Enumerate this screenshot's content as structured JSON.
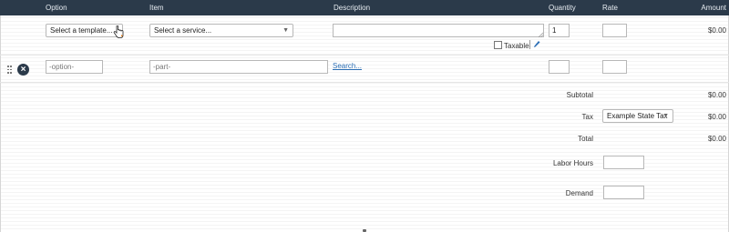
{
  "header": {
    "option": "Option",
    "item": "Item",
    "description": "Description",
    "quantity": "Quantity",
    "rate": "Rate",
    "amount": "Amount"
  },
  "row1": {
    "template_select": "Select a template...",
    "service_select": "Select a service...",
    "description_value": "",
    "quantity_value": "1",
    "rate_value": "",
    "amount": "$0.00",
    "taxable_label": "Taxable"
  },
  "row2": {
    "option_placeholder": "-option-",
    "part_placeholder": "-part-",
    "search_link": "Search...",
    "quantity_value": "",
    "rate_value": ""
  },
  "totals": {
    "subtotal_label": "Subtotal",
    "subtotal_value": "$0.00",
    "tax_label": "Tax",
    "tax_select": "Example State Tax",
    "tax_value": "$0.00",
    "total_label": "Total",
    "total_value": "$0.00",
    "labor_hours_label": "Labor Hours",
    "labor_hours_value": "",
    "demand_label": "Demand",
    "demand_value": ""
  },
  "icons": {
    "remove": "close-circle-icon",
    "drag": "drag-handle-icon",
    "edit": "pencil-icon",
    "dropdown": "chevron-down-icon"
  },
  "colors": {
    "header_bg": "#2b3a4a",
    "link": "#2c6fb5"
  }
}
